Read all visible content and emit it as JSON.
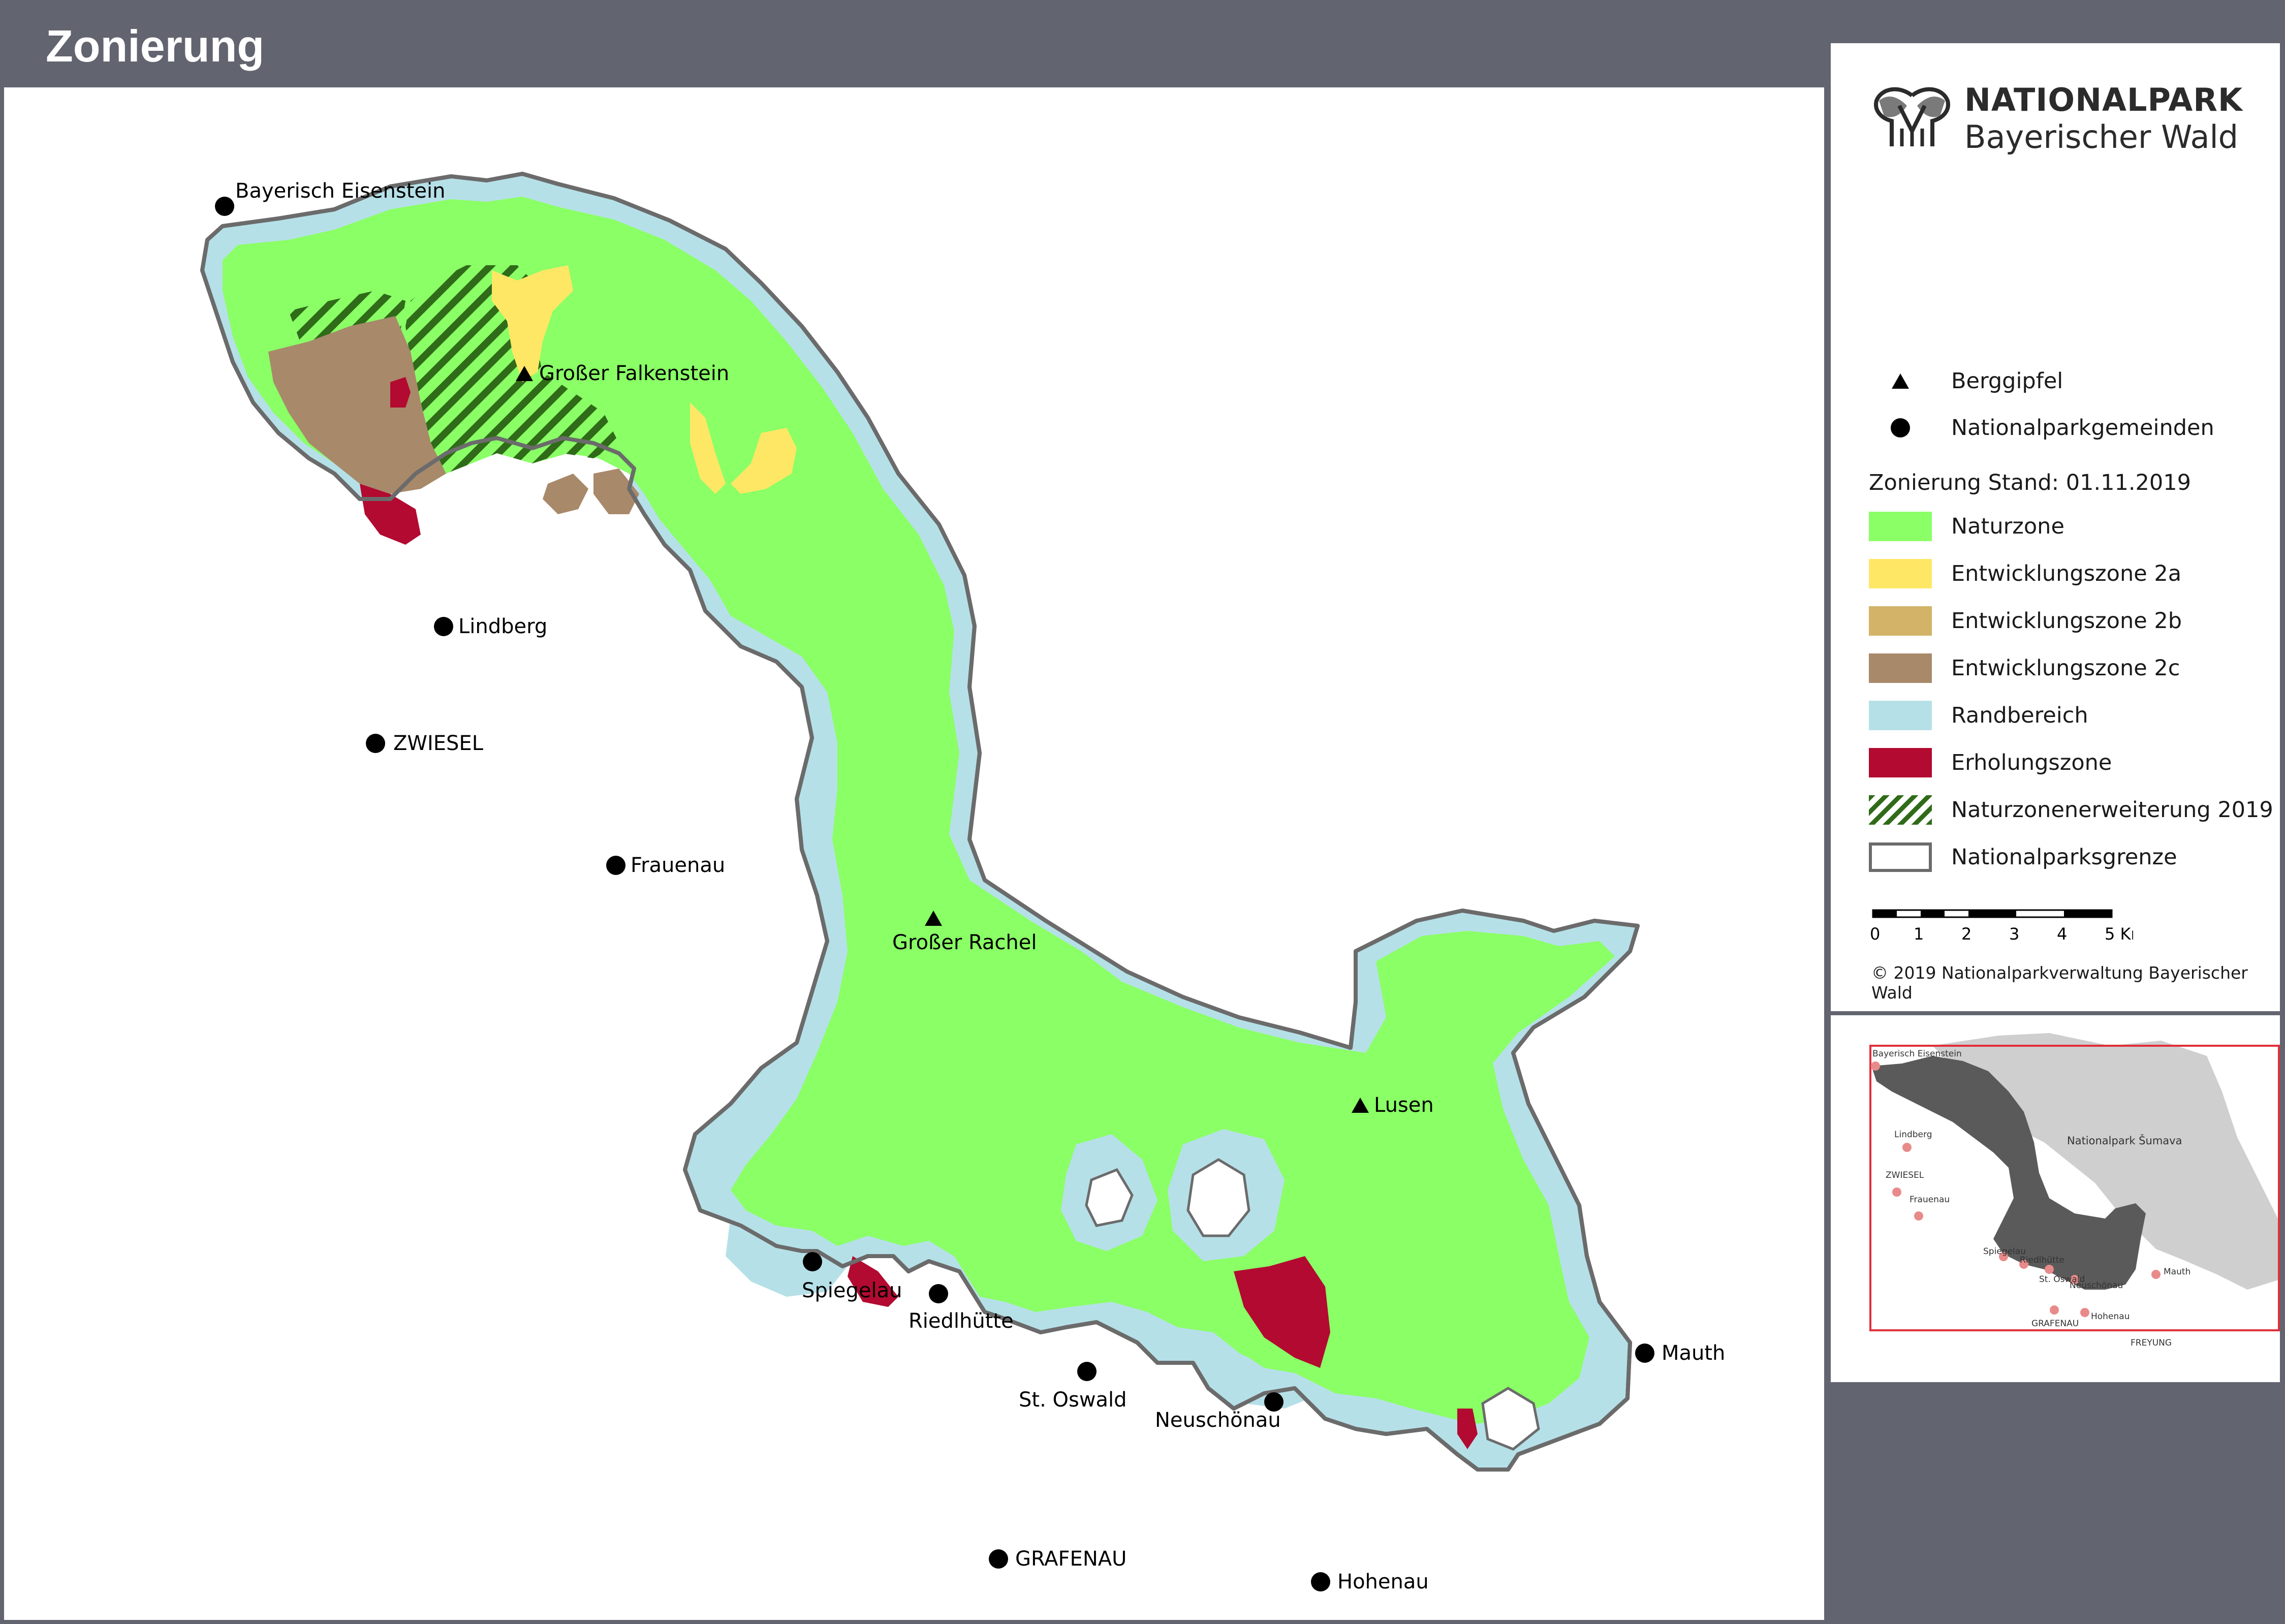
{
  "header": {
    "title": "Zonierung"
  },
  "map": {
    "colors": {
      "naturzone": "#8aff66",
      "zone2a": "#ffe766",
      "zone2b": "#d2b367",
      "zone2c": "#a8896a",
      "randbereich": "#b6e0e8",
      "erholungszone": "#b20a30",
      "hatch": "#2f6b18",
      "border": "#6b6b6b"
    },
    "towns": {
      "bayerisch_eisenstein": "Bayerisch Eisenstein",
      "lindberg": "Lindberg",
      "zwiesel": "ZWIESEL",
      "frauenau": "Frauenau",
      "spiegelau": "Spiegelau",
      "riedlhuette": "Riedlhütte",
      "st_oswald": "St. Oswald",
      "neuschoenau": "Neuschönau",
      "mauth": "Mauth",
      "grafenau": "GRAFENAU",
      "hohenau": "Hohenau"
    },
    "peaks": {
      "falkenstein": "Großer Falkenstein",
      "rachel": "Großer Rachel",
      "lusen": "Lusen"
    }
  },
  "panel": {
    "logo": {
      "line1": "NATIONALPARK",
      "line2": "Bayerischer Wald"
    },
    "legend": {
      "berggipfel": "Berggipfel",
      "gemeinden": "Nationalparkgemeinden",
      "stand": "Zonierung Stand: 01.11.2019",
      "naturzone": "Naturzone",
      "zone2a": "Entwicklungszone 2a",
      "zone2b": "Entwicklungszone 2b",
      "zone2c": "Entwicklungszone 2c",
      "randbereich": "Randbereich",
      "erholungszone": "Erholungszone",
      "erweiterung": "Naturzonenerweiterung 2019",
      "grenze": "Nationalparksgrenze"
    },
    "scale": {
      "t0": "0",
      "t1": "1",
      "t2": "2",
      "t3": "3",
      "t4": "4",
      "t5": "5 Km"
    },
    "copyright": "© 2019 Nationalparkverwaltung Bayerischer Wald",
    "inset": {
      "sumava": "Nationalpark Šumava",
      "bayerisch_eisenstein": "Bayerisch Eisenstein",
      "lindberg": "Lindberg",
      "zwiesel": "ZWIESEL",
      "frauenau": "Frauenau",
      "spiegelau": "Spiegelau",
      "riedlhuette": "Riedlhütte",
      "st_oswald": "St. Oswald",
      "neuschoenau": "Neuschönau",
      "mauth": "Mauth",
      "grafenau": "GRAFENAU",
      "hohenau": "Hohenau",
      "freyung": "FREYUNG"
    }
  }
}
